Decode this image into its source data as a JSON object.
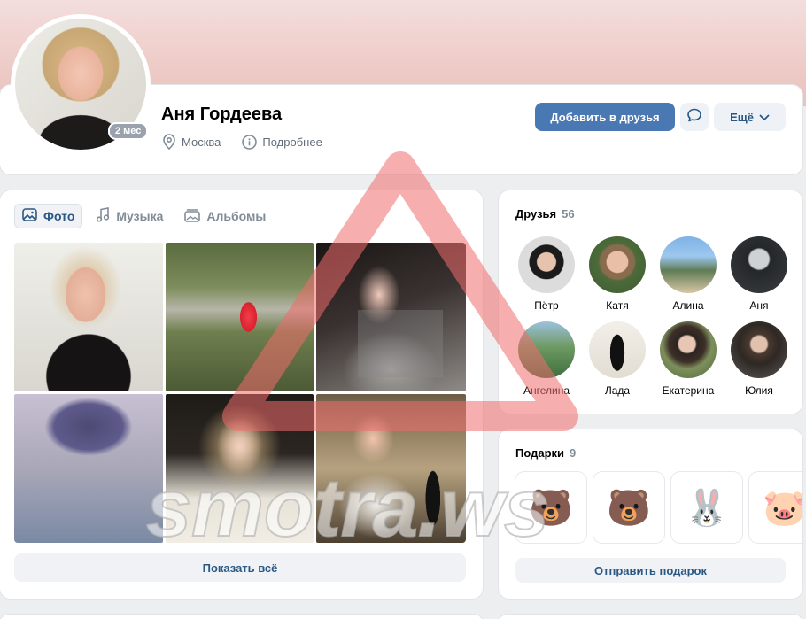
{
  "profile": {
    "name": "Аня Гордеева",
    "online_badge": "2 мес",
    "city": "Москва",
    "details_link": "Подробнее",
    "add_friend_label": "Добавить в друзья",
    "more_label": "Ещё"
  },
  "photos": {
    "tabs": [
      {
        "label": "Фото",
        "icon": "image-icon",
        "active": true
      },
      {
        "label": "Музыка",
        "icon": "music-note-icon",
        "active": false
      },
      {
        "label": "Альбомы",
        "icon": "album-icon",
        "active": false
      }
    ],
    "show_all_label": "Показать всё"
  },
  "friends": {
    "title": "Друзья",
    "count": "56",
    "items": [
      {
        "name": "Пётр"
      },
      {
        "name": "Катя"
      },
      {
        "name": "Алина"
      },
      {
        "name": "Аня"
      },
      {
        "name": "Ангелина"
      },
      {
        "name": "Лада"
      },
      {
        "name": "Екатерина"
      },
      {
        "name": "Юлия"
      }
    ]
  },
  "gifts": {
    "title": "Подарки",
    "count": "9",
    "items": [
      {
        "icon": "bear-party-sticker",
        "glyph": "🐻"
      },
      {
        "icon": "bear-party-sticker",
        "glyph": "🐻"
      },
      {
        "icon": "bunny-sticker",
        "glyph": "🐰"
      },
      {
        "icon": "pig-gift-sticker",
        "glyph": "🐷"
      }
    ],
    "send_label": "Отправить подарок"
  },
  "watermark": {
    "text": "smotra.ws"
  },
  "colors": {
    "accent": "#4a78b3",
    "link": "#2a5885",
    "secondary_text": "#818c99",
    "page_bg": "#edeef0"
  }
}
